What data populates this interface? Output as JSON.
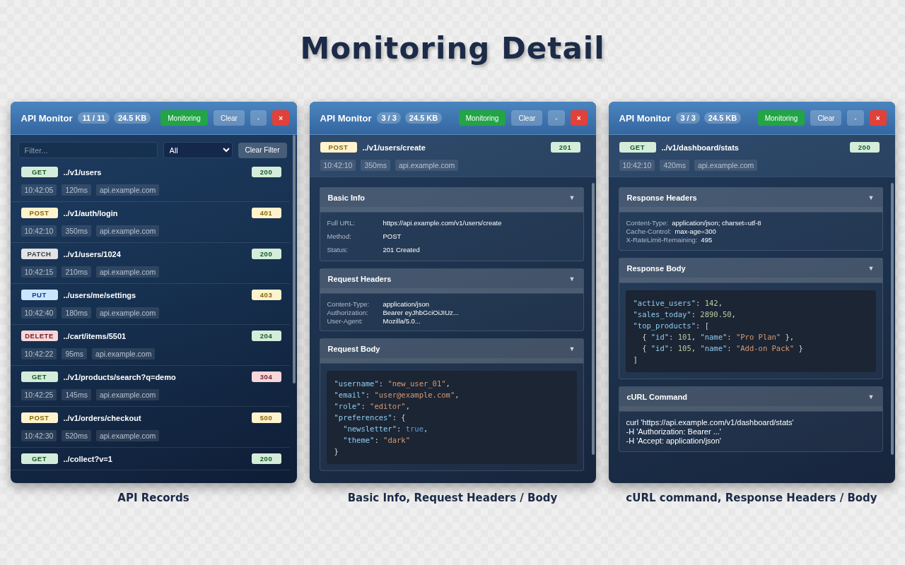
{
  "heading": "Monitoring Detail",
  "panels": [
    {
      "kind": "list",
      "title": "API Monitor",
      "count": "11 / 11",
      "size": "24.5 KB",
      "caption": "API Records",
      "buttons": [
        {
          "label": "Monitoring",
          "kind": "monitor"
        },
        {
          "label": "Clear",
          "kind": "plain"
        },
        {
          "label": "-",
          "kind": "plain"
        },
        {
          "label": "×",
          "kind": "danger"
        }
      ],
      "filter": {
        "placeholder": "Filter..."
      },
      "select": {
        "value": "All"
      },
      "clear_filter": "Clear Filter",
      "records": [
        {
          "method": {
            "label": "GET",
            "color": "#d4edda"
          },
          "path": "../v1/users",
          "status": {
            "label": "200",
            "color": "#d4edda"
          },
          "meta": [
            "10:42:05",
            "120ms",
            "api.example.com"
          ]
        },
        {
          "method": {
            "label": "POST",
            "color": "#fff3cd"
          },
          "path": "../v1/auth/login",
          "status": {
            "label": "401",
            "color": "#fff3cd"
          },
          "meta": [
            "10:42:10",
            "350ms",
            "api.example.com"
          ]
        },
        {
          "method": {
            "label": "PATCH",
            "color": "#e2e3e5"
          },
          "path": "../v1/users/1024",
          "status": {
            "label": "200",
            "color": "#d4edda"
          },
          "meta": [
            "10:42:15",
            "210ms",
            "api.example.com"
          ]
        },
        {
          "method": {
            "label": "PUT",
            "color": "#cce5ff"
          },
          "path": "../users/me/settings",
          "status": {
            "label": "403",
            "color": "#fff3cd"
          },
          "meta": [
            "10:42:40",
            "180ms",
            "api.example.com"
          ]
        },
        {
          "method": {
            "label": "DELETE",
            "color": "#f8d7da"
          },
          "path": "../cart/items/5501",
          "status": {
            "label": "204",
            "color": "#d4edda"
          },
          "meta": [
            "10:42:22",
            "95ms",
            "api.example.com"
          ]
        },
        {
          "method": {
            "label": "GET",
            "color": "#d4edda"
          },
          "path": "../v1/products/search?q=demo",
          "status": {
            "label": "304",
            "color": "#f8d7da"
          },
          "meta": [
            "10:42:25",
            "145ms",
            "api.example.com"
          ]
        },
        {
          "method": {
            "label": "POST",
            "color": "#fff3cd"
          },
          "path": "../v1/orders/checkout",
          "status": {
            "label": "500",
            "color": "#fff3cd"
          },
          "meta": [
            "10:42:30",
            "520ms",
            "api.example.com"
          ]
        },
        {
          "method": {
            "label": "GET",
            "color": "#d4edda"
          },
          "path": "../collect?v=1",
          "status": {
            "label": "200",
            "color": "#d4edda"
          }
        }
      ]
    },
    {
      "kind": "detail",
      "title": "API Monitor",
      "count": "3 / 3",
      "size": "24.5 KB",
      "caption": "Basic Info, Request Headers / Body",
      "buttons": [
        {
          "label": "Monitoring",
          "kind": "monitor"
        },
        {
          "label": "Clear",
          "kind": "plain"
        },
        {
          "label": "-",
          "kind": "plain"
        },
        {
          "label": "×",
          "kind": "danger"
        }
      ],
      "request": {
        "method": {
          "label": "POST",
          "color": "#fff3cd"
        },
        "path": "../v1/users/create",
        "status": {
          "label": "201",
          "color": "#d4edda"
        },
        "meta": [
          "10:42:10",
          "350ms",
          "api.example.com"
        ]
      },
      "sections": [
        {
          "title": "Basic Info",
          "toggle": "▼",
          "expanded": true,
          "kind": "fields",
          "rows": [
            {
              "label": "Full URL:",
              "value": "https://api.example.com/v1/users/create"
            },
            {
              "label": "Method:",
              "value": "POST"
            },
            {
              "label": "Status:",
              "value": "201 Created"
            }
          ]
        },
        {
          "title": "Request Headers",
          "toggle": "▼",
          "expanded": true,
          "kind": "table",
          "rows": [
            {
              "label": "Content-Type:",
              "value": "application/json"
            },
            {
              "label": "Authorization:",
              "value": "Bearer eyJhbGciOiJIUz..."
            },
            {
              "label": "User-Agent:",
              "value": "Mozilla/5.0..."
            }
          ]
        },
        {
          "title": "Request Body",
          "toggle": "▼",
          "expanded": true,
          "kind": "code",
          "lines": [
            [
              {
                "kind": "key",
                "text": "\"username\""
              },
              {
                "kind": "punct",
                "text": ": "
              },
              {
                "kind": "string",
                "text": "\"new_user_01\""
              },
              {
                "kind": "punct",
                "text": ","
              }
            ],
            [
              {
                "kind": "key",
                "text": "\"email\""
              },
              {
                "kind": "punct",
                "text": ": "
              },
              {
                "kind": "string",
                "text": "\"user@example.com\""
              },
              {
                "kind": "punct",
                "text": ","
              }
            ],
            [
              {
                "kind": "key",
                "text": "\"role\""
              },
              {
                "kind": "punct",
                "text": ": "
              },
              {
                "kind": "string",
                "text": "\"editor\""
              },
              {
                "kind": "punct",
                "text": ","
              }
            ],
            [
              {
                "kind": "key",
                "text": "\"preferences\""
              },
              {
                "kind": "punct",
                "text": ": {"
              }
            ],
            [
              {
                "kind": "key",
                "text": "  \"newsletter\""
              },
              {
                "kind": "punct",
                "text": ": "
              },
              {
                "kind": "bool",
                "text": "true"
              },
              {
                "kind": "punct",
                "text": ","
              }
            ],
            [
              {
                "kind": "key",
                "text": "  \"theme\""
              },
              {
                "kind": "punct",
                "text": ": "
              },
              {
                "kind": "string",
                "text": "\"dark\""
              }
            ],
            [
              {
                "kind": "punct",
                "text": "}"
              }
            ]
          ]
        }
      ]
    },
    {
      "kind": "detail",
      "title": "API Monitor",
      "count": "3 / 3",
      "size": "24.5 KB",
      "caption": "cURL command, Response Headers / Body",
      "buttons": [
        {
          "label": "Monitoring",
          "kind": "monitor"
        },
        {
          "label": "Clear",
          "kind": "plain"
        },
        {
          "label": "-",
          "kind": "plain"
        },
        {
          "label": "×",
          "kind": "danger"
        }
      ],
      "request": {
        "method": {
          "label": "GET",
          "color": "#d4edda"
        },
        "path": "../v1/dashboard/stats",
        "status": {
          "label": "200",
          "color": "#d4edda"
        },
        "meta": [
          "10:42:10",
          "420ms",
          "api.example.com"
        ]
      },
      "sections": [
        {
          "title": "Response Headers",
          "toggle": "▼",
          "expanded": true,
          "kind": "inline",
          "rows": [
            {
              "label": "Content-Type:",
              "value": "application/json; charset=utf-8"
            },
            {
              "label": "Cache-Control:",
              "value": "max-age=300"
            },
            {
              "label": "X-RateLimit-Remaining:",
              "value": "495"
            }
          ]
        },
        {
          "title": "Response Body",
          "toggle": "▼",
          "expanded": true,
          "kind": "code",
          "lines": [
            [
              {
                "kind": "key",
                "text": "\"active_users\""
              },
              {
                "kind": "punct",
                "text": ": "
              },
              {
                "kind": "number",
                "text": "142"
              },
              {
                "kind": "punct",
                "text": ","
              }
            ],
            [
              {
                "kind": "key",
                "text": "\"sales_today\""
              },
              {
                "kind": "punct",
                "text": ": "
              },
              {
                "kind": "number",
                "text": "2890.50"
              },
              {
                "kind": "punct",
                "text": ","
              }
            ],
            [
              {
                "kind": "key",
                "text": "\"top_products\""
              },
              {
                "kind": "punct",
                "text": ": ["
              }
            ],
            [
              {
                "kind": "punct",
                "text": "  { "
              },
              {
                "kind": "key",
                "text": "\"id\""
              },
              {
                "kind": "punct",
                "text": ": "
              },
              {
                "kind": "number",
                "text": "101"
              },
              {
                "kind": "punct",
                "text": ", "
              },
              {
                "kind": "key",
                "text": "\"name\""
              },
              {
                "kind": "punct",
                "text": ": "
              },
              {
                "kind": "string",
                "text": "\"Pro Plan\""
              },
              {
                "kind": "punct",
                "text": " },"
              }
            ],
            [
              {
                "kind": "punct",
                "text": "  { "
              },
              {
                "kind": "key",
                "text": "\"id\""
              },
              {
                "kind": "punct",
                "text": ": "
              },
              {
                "kind": "number",
                "text": "105"
              },
              {
                "kind": "punct",
                "text": ", "
              },
              {
                "kind": "key",
                "text": "\"name\""
              },
              {
                "kind": "punct",
                "text": ": "
              },
              {
                "kind": "string",
                "text": "\"Add-on Pack\""
              },
              {
                "kind": "punct",
                "text": " }"
              }
            ],
            [
              {
                "kind": "punct",
                "text": "]"
              }
            ]
          ]
        },
        {
          "title": "cURL Command",
          "toggle": "▼",
          "expanded": true,
          "kind": "text",
          "lines": [
            "curl 'https://api.example.com/v1/dashboard/stats'",
            "-H 'Authorization: Bearer ...'",
            "-H 'Accept: application/json'"
          ]
        }
      ]
    }
  ]
}
